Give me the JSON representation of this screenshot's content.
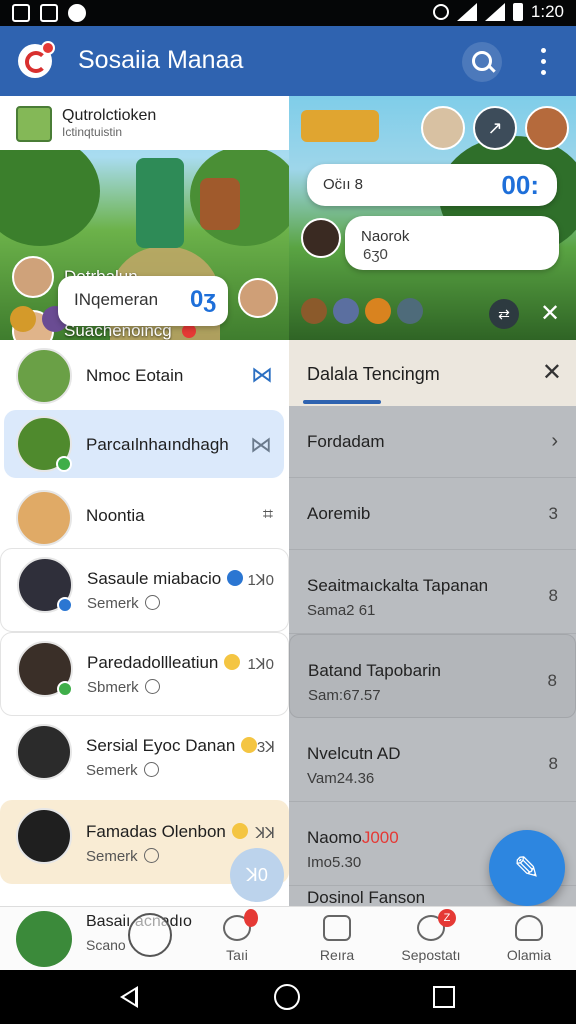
{
  "status_bar": {
    "time": "1:20"
  },
  "app_bar": {
    "title": "Sosaiia Manaa"
  },
  "hero": {
    "card_title": "Qutrolctioken",
    "card_subtitle": "Ictinqtuistin",
    "users": [
      {
        "name": "Dotrbalun"
      },
      {
        "name": "Suachenoincg"
      }
    ],
    "pill": {
      "text": "INqemeran",
      "count": "0ʒ"
    },
    "right": {
      "bubble1": {
        "text": "Oc̈ıı 8",
        "count": "00:"
      },
      "bubble2": {
        "title": "Naorok",
        "sub": "6ʒ0"
      }
    }
  },
  "contacts": [
    {
      "name": "Nmoc Eotain",
      "action": "⋈"
    },
    {
      "name": "Parcaılnhaındhagh",
      "action": "⋈"
    },
    {
      "name": "Noontia",
      "action": "⌗"
    },
    {
      "name": "Sasaule miabacio",
      "sub": "Semerk",
      "meta": "1ꓘ0"
    },
    {
      "name": "Paredadollleatiun",
      "sub": "Sbmerk",
      "meta": "1ꓘ0"
    },
    {
      "name": "Sersial Eyoc Danan",
      "sub": "Semerk",
      "meta": "3ꓘ"
    },
    {
      "name": "Famadas Olenbon",
      "sub": "Semerk",
      "meta": "ꓘꓘ"
    }
  ],
  "peek": {
    "name": "Basaiı acnadıo",
    "sub": "Scano"
  },
  "panel": {
    "title": "Dalala Tencingm",
    "items": [
      {
        "title": "Fordadam",
        "value": "›"
      },
      {
        "title": "Aoremib",
        "value": "3"
      },
      {
        "title": "Seaitmaıckalta Tapanan",
        "sub": "Sama2 61",
        "value": "8"
      },
      {
        "title": "Batand Tapobarin",
        "sub": "Sam:67.57",
        "value": "8"
      },
      {
        "title": "Nvelcutn AD",
        "sub": "Vam24.36",
        "value": "8"
      },
      {
        "title": "Naomo",
        "title_red": "J000",
        "sub": "Imo5.30"
      },
      {
        "title": "Dosinol Fanson"
      }
    ]
  },
  "bottom_nav": [
    {
      "label": "Taıi",
      "badge": ""
    },
    {
      "label": "Reıra"
    },
    {
      "label": "Sepostatı",
      "badge": "Z"
    },
    {
      "label": "Olamia"
    }
  ],
  "mic_fab_label": "ꓘ0"
}
